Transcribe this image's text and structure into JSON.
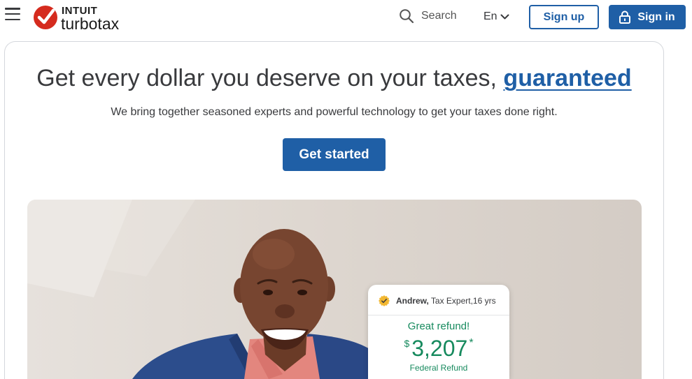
{
  "header": {
    "menu_icon": "hamburger-menu-icon",
    "logo": {
      "icon": "checkmark-icon",
      "brand_top": "INTUIT",
      "brand_bottom": "turbotax"
    },
    "search": {
      "icon": "search-icon",
      "label": "Search"
    },
    "language": {
      "label": "En",
      "icon": "chevron-down-icon"
    },
    "sign_up_label": "Sign up",
    "sign_in": {
      "icon": "lock-icon",
      "label": "Sign in"
    }
  },
  "hero": {
    "heading": "Get every dollar you deserve on your taxes,",
    "heading_link": "guaranteed",
    "subtitle": "We bring together seasoned experts and powerful technology to get your taxes done right.",
    "cta_label": "Get started"
  },
  "expert_card": {
    "badge_icon": "verified-badge-icon",
    "expert_name": "Andrew,",
    "expert_role": "Tax Expert,16 yrs",
    "headline": "Great refund!",
    "currency_symbol": "$",
    "refund_amount": "3,207",
    "footnote_marker": "*",
    "refund_label": "Federal Refund"
  },
  "colors": {
    "brand_blue": "#1f5fa6",
    "text_dark": "#393a3d",
    "refund_green": "#178a5e",
    "logo_red": "#d52b1e",
    "badge_gold": "#f2b731"
  }
}
